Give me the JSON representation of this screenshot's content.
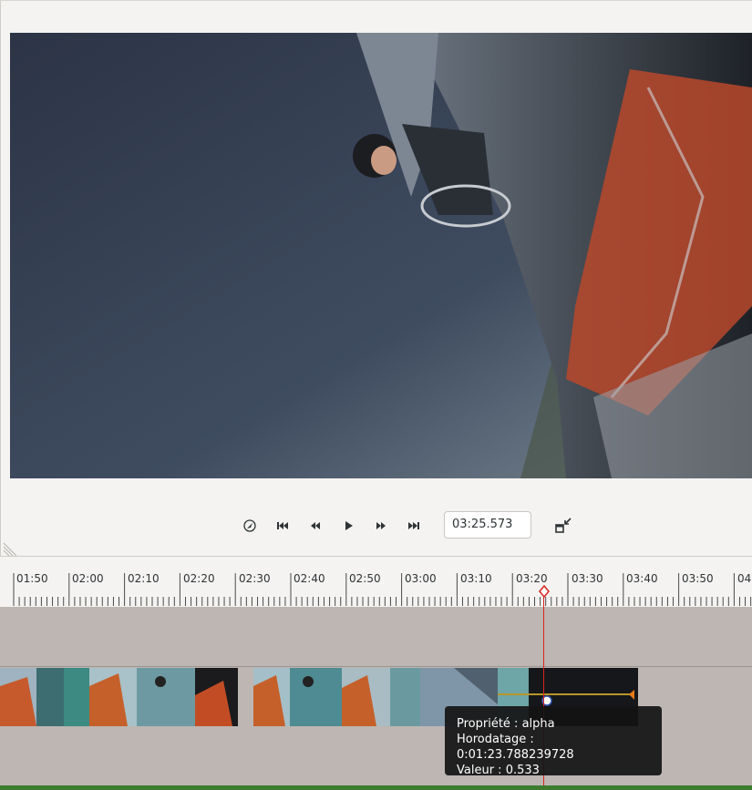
{
  "transport": {
    "timecode": "03:25.573",
    "icons": [
      "rewind-to-marker-icon",
      "skip-to-start-icon",
      "step-back-icon",
      "play-icon",
      "step-forward-icon",
      "skip-to-end-icon",
      "exit-fullscreen-icon"
    ]
  },
  "ruler": {
    "labels": [
      "01:50",
      "02:00",
      "02:10",
      "02:20",
      "02:30",
      "02:40",
      "02:50",
      "03:00",
      "03:10",
      "03:20",
      "03:30",
      "03:40",
      "03:50",
      "04"
    ]
  },
  "tooltip": {
    "line1": "Propriété : alpha",
    "line2": "Horodatage : 0:01:23.788239728",
    "line3": "Valeur : 0.533"
  },
  "colors": {
    "playhead": "#d8241e",
    "keyframe": "#e57a1a",
    "track_bg": "#bdb6b2",
    "bottom_bar": "#3d7b2e"
  }
}
